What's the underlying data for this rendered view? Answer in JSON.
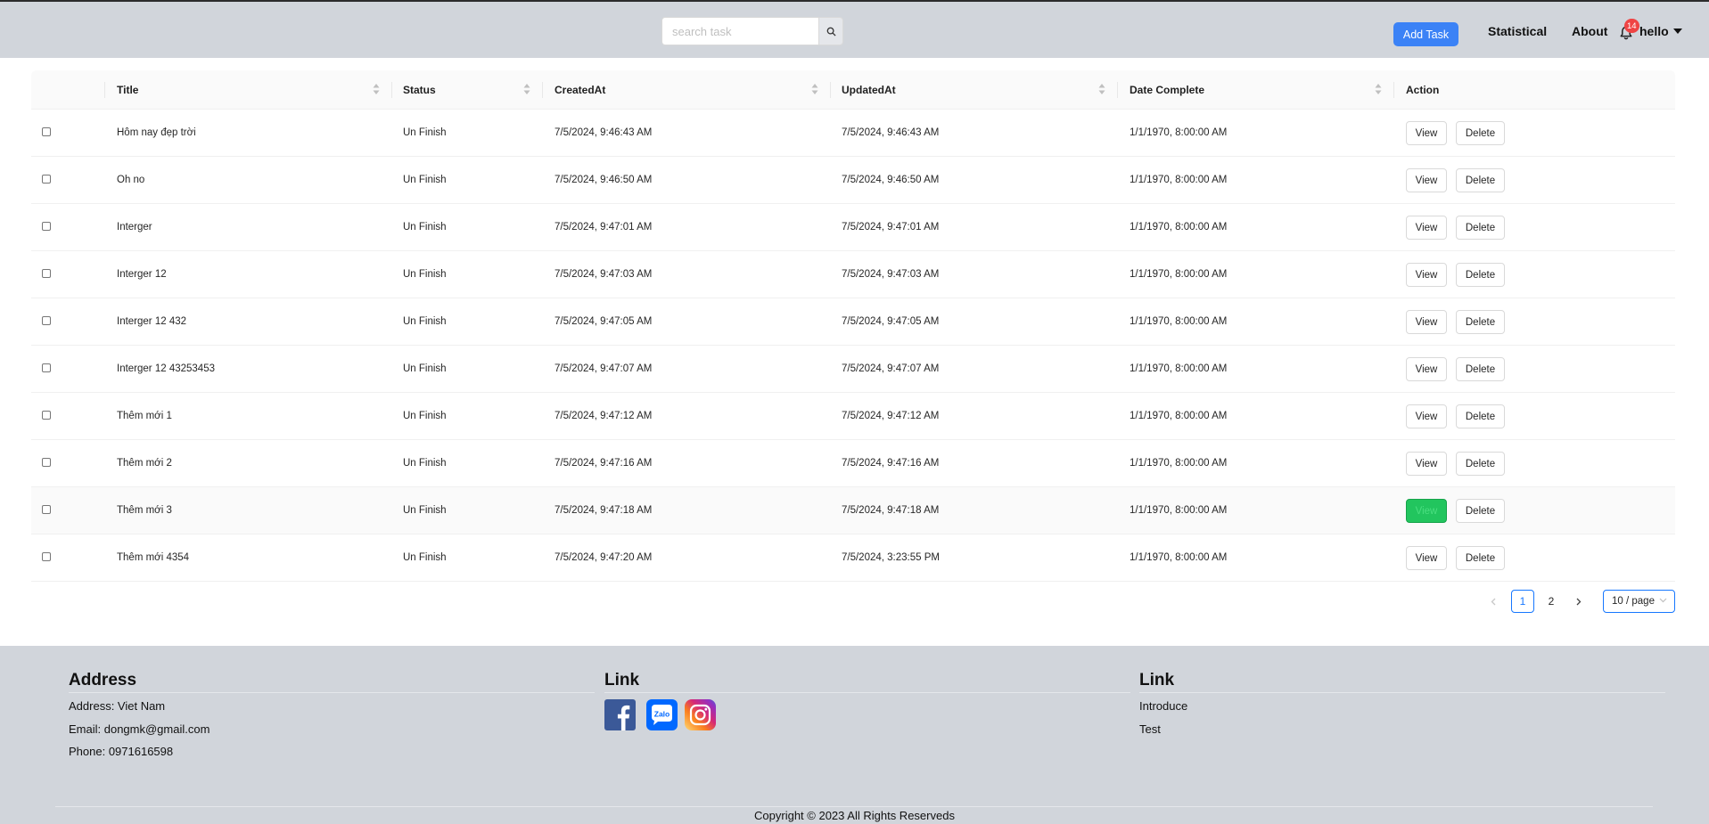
{
  "header": {
    "search_placeholder": "search task",
    "add_task_label": "Add Task",
    "nav": {
      "statistical": "Statistical",
      "about": "About"
    },
    "notification_count": "14",
    "user_name": "hello"
  },
  "table": {
    "columns": [
      "Title",
      "Status",
      "CreatedAt",
      "UpdatedAt",
      "Date Complete",
      "Action"
    ],
    "view_label": "View",
    "delete_label": "Delete",
    "rows": [
      {
        "title": "Hôm nay đẹp trời",
        "status": "Un Finish",
        "created": "7/5/2024, 9:46:43 AM",
        "updated": "7/5/2024, 9:46:43 AM",
        "complete": "1/1/1970, 8:00:00 AM"
      },
      {
        "title": "Oh no",
        "status": "Un Finish",
        "created": "7/5/2024, 9:46:50 AM",
        "updated": "7/5/2024, 9:46:50 AM",
        "complete": "1/1/1970, 8:00:00 AM"
      },
      {
        "title": "Interger",
        "status": "Un Finish",
        "created": "7/5/2024, 9:47:01 AM",
        "updated": "7/5/2024, 9:47:01 AM",
        "complete": "1/1/1970, 8:00:00 AM"
      },
      {
        "title": "Interger 12",
        "status": "Un Finish",
        "created": "7/5/2024, 9:47:03 AM",
        "updated": "7/5/2024, 9:47:03 AM",
        "complete": "1/1/1970, 8:00:00 AM"
      },
      {
        "title": "Interger 12 432",
        "status": "Un Finish",
        "created": "7/5/2024, 9:47:05 AM",
        "updated": "7/5/2024, 9:47:05 AM",
        "complete": "1/1/1970, 8:00:00 AM"
      },
      {
        "title": "Interger 12 43253453",
        "status": "Un Finish",
        "created": "7/5/2024, 9:47:07 AM",
        "updated": "7/5/2024, 9:47:07 AM",
        "complete": "1/1/1970, 8:00:00 AM"
      },
      {
        "title": "Thêm mới 1",
        "status": "Un Finish",
        "created": "7/5/2024, 9:47:12 AM",
        "updated": "7/5/2024, 9:47:12 AM",
        "complete": "1/1/1970, 8:00:00 AM"
      },
      {
        "title": "Thêm mới 2",
        "status": "Un Finish",
        "created": "7/5/2024, 9:47:16 AM",
        "updated": "7/5/2024, 9:47:16 AM",
        "complete": "1/1/1970, 8:00:00 AM"
      },
      {
        "title": "Thêm mới 3",
        "status": "Un Finish",
        "created": "7/5/2024, 9:47:18 AM",
        "updated": "7/5/2024, 9:47:18 AM",
        "complete": "1/1/1970, 8:00:00 AM"
      },
      {
        "title": "Thêm mới 4354",
        "status": "Un Finish",
        "created": "7/5/2024, 9:47:20 AM",
        "updated": "7/5/2024, 3:23:55 PM",
        "complete": "1/1/1970, 8:00:00 AM"
      }
    ]
  },
  "pagination": {
    "pages": [
      "1",
      "2"
    ],
    "current": "1",
    "page_size": "10 / page"
  },
  "footer": {
    "address": {
      "heading": "Address",
      "lines": [
        "Address: Viet Nam",
        "Email: dongmk@gmail.com",
        "Phone: 0971616598"
      ]
    },
    "social": {
      "heading": "Link",
      "icons": [
        "facebook-icon",
        "zalo-icon",
        "instagram-icon"
      ],
      "zalo_text": "Zalo"
    },
    "links": {
      "heading": "Link",
      "items": [
        "Introduce",
        "Test"
      ]
    },
    "copyright": "Copyright © 2023 All Rights Reserveds"
  },
  "colors": {
    "header_bg": "#d1d5db",
    "primary": "#3b82f6",
    "badge": "#ef4444",
    "active_view": "#22c55e"
  }
}
